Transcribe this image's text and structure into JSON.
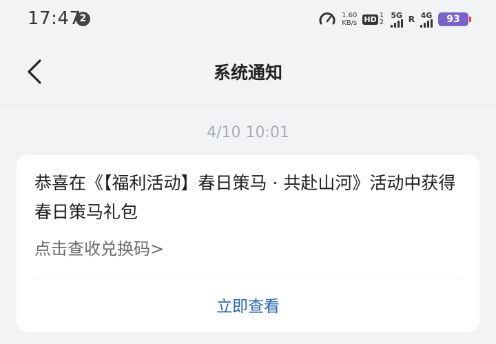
{
  "status_bar": {
    "time": "17:47",
    "notification_count": "2",
    "net_speed_value": "1.60",
    "net_speed_unit": "KB/s",
    "hd_label": "HD",
    "sim1": "1",
    "sim2": "2",
    "signal1_label": "5G",
    "roaming": "R",
    "signal2_label": "4G",
    "battery": "93",
    "battery_color": "#7b62c9"
  },
  "header": {
    "back_icon": "chevron-left-icon",
    "title": "系统通知"
  },
  "message": {
    "timestamp": "4/10  10:01",
    "title": "恭喜在《【福利活动】春日策马 · 共赴山河》活动中获得春日策马礼包",
    "link_text": "点击查收兑换码>",
    "action_label": "立即查看",
    "action_color": "#2a66a8"
  }
}
